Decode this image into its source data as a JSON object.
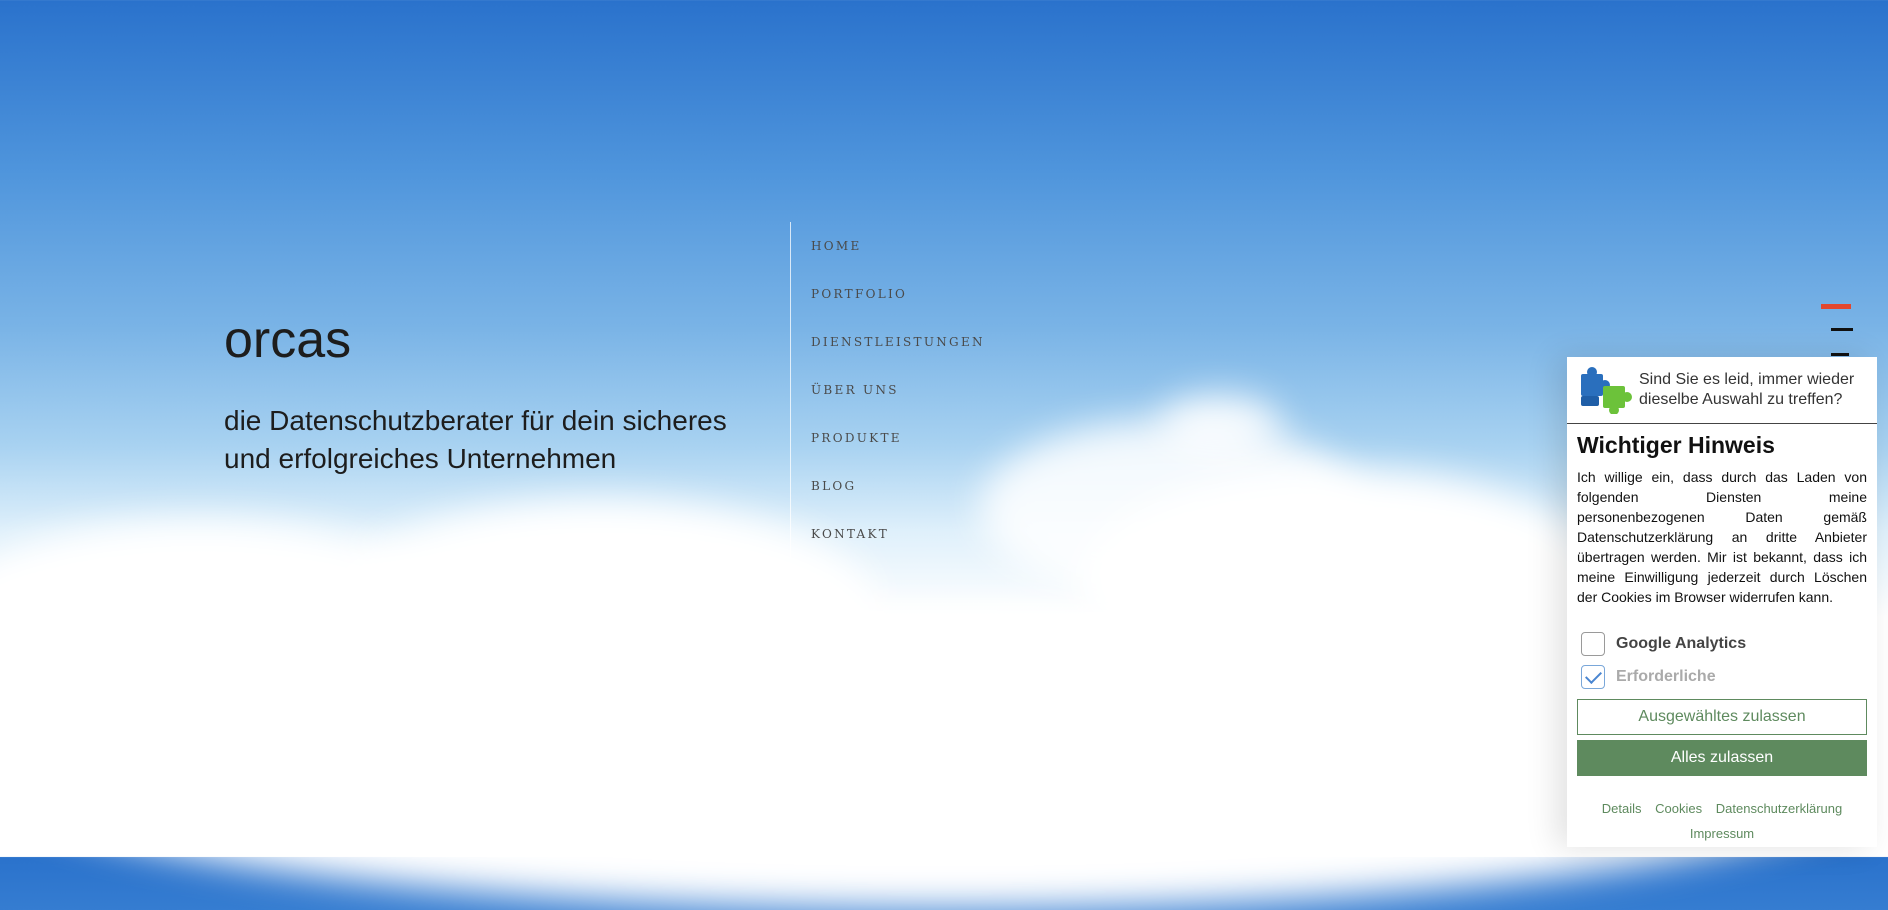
{
  "brand": {
    "name": "orcas",
    "tagline": "die Datenschutzberater für dein sicheres und erfolgreiches Unternehmen"
  },
  "nav": {
    "items": [
      {
        "label": "HOME"
      },
      {
        "label": "PORTFOLIO"
      },
      {
        "label": "DIENSTLEISTUNGEN"
      },
      {
        "label": "ÜBER UNS"
      },
      {
        "label": "PRODUKTE"
      },
      {
        "label": "BLOG"
      },
      {
        "label": "KONTAKT"
      }
    ]
  },
  "menu_toggle": {
    "icon": "hamburger-menu-icon",
    "accent": "#e2472f"
  },
  "cookie_banner": {
    "icon": "puzzle-icon",
    "question": "Sind Sie es leid, immer wieder dieselbe Auswahl zu treffen?",
    "title": "Wichtiger Hinweis",
    "text": "Ich willige ein, dass durch das Laden von folgenden Diensten meine personenbezogenen Daten gemäß Datenschutzerklärung an dritte Anbieter übertragen werden. Mir ist bekannt, dass ich meine Einwilligung jederzeit durch Löschen der Cookies im Browser widerrufen kann.",
    "options": [
      {
        "label": "Google Analytics",
        "checked": false
      },
      {
        "label": "Erforderliche",
        "checked": true
      }
    ],
    "buttons": {
      "accept_selected": "Ausgewähltes zulassen",
      "accept_all": "Alles zulassen"
    },
    "links": [
      "Details",
      "Cookies",
      "Datenschutzerklärung",
      "Impressum"
    ],
    "colors": {
      "accent": "#5e8a5e"
    }
  }
}
